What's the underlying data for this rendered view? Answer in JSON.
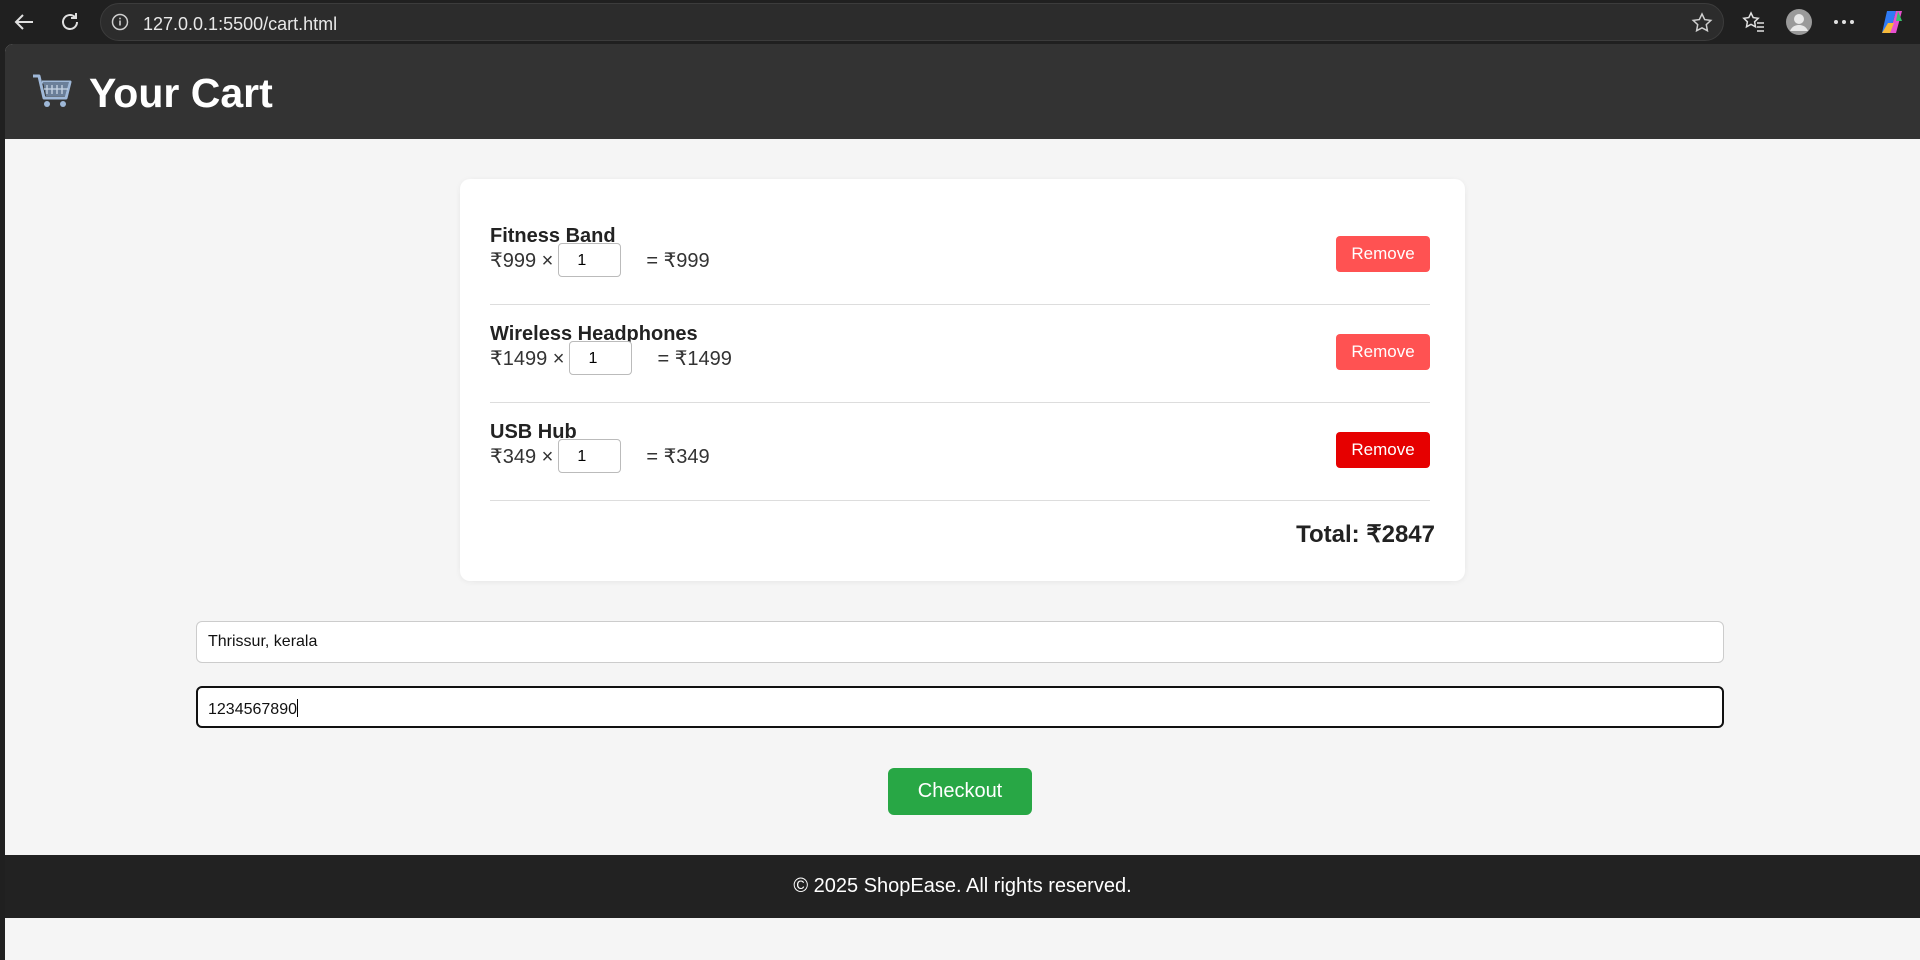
{
  "browser": {
    "url": "127.0.0.1:5500/cart.html",
    "icons": [
      "back-icon",
      "reload-icon",
      "info-icon",
      "star-icon",
      "favorites-icon",
      "profile-icon",
      "more-icon",
      "copilot-icon"
    ]
  },
  "header": {
    "title": "Your Cart",
    "icon": "shopping-cart-icon"
  },
  "cart": {
    "items": [
      {
        "name": "Fitness Band",
        "price": "₹999 ×",
        "qty": "1",
        "subtotal": "= ₹999",
        "remove_label": "Remove"
      },
      {
        "name": "Wireless Headphones",
        "price": "₹1499 ×",
        "qty": "1",
        "subtotal": "= ₹1499",
        "remove_label": "Remove"
      },
      {
        "name": "USB Hub",
        "price": "₹349 ×",
        "qty": "1",
        "subtotal": "= ₹349",
        "remove_label": "Remove"
      }
    ],
    "total": "Total: ₹2847"
  },
  "form": {
    "address_value": "Thrissur, kerala",
    "phone_value": "1234567890",
    "checkout_label": "Checkout"
  },
  "footer": {
    "text": "© 2025 ShopEase. All rights reserved."
  },
  "colors": {
    "header_bg": "#333333",
    "remove_button": "#ff5252",
    "remove_button_hover": "#e60000",
    "checkout_button": "#28a745",
    "footer_bg": "#222222"
  }
}
